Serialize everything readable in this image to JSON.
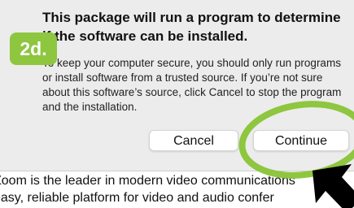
{
  "dialog": {
    "title": "This package will run a program to determine if the software can be installed.",
    "body": "To keep your computer secure, you should only run programs or install software from a trusted source. If you’re not sure about this software’s source, click Cancel to stop the program and the installation.",
    "cancel_label": "Cancel",
    "continue_label": "Continue"
  },
  "step_badge": {
    "label": "2d.",
    "color": "#8ec63f"
  },
  "page_text": {
    "line1": "Zoom is the leader in modern video communications",
    "line2": "easy, reliable platform for video and audio confer"
  },
  "annotations": {
    "highlight_circle_color": "#8ec63f",
    "pointer_arrow_color": "#000000",
    "pointer_icon": "cursor-arrow-icon"
  }
}
